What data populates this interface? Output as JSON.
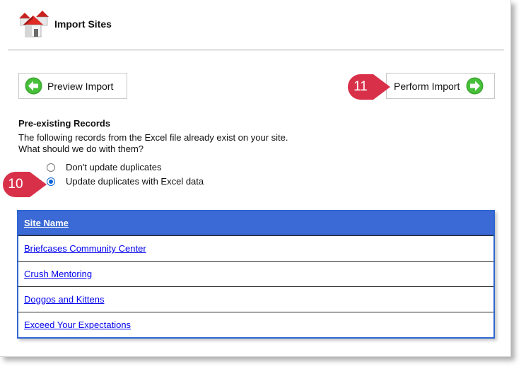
{
  "header": {
    "title": "Import Sites",
    "icon": "houses-icon"
  },
  "toolbar": {
    "preview_label": "Preview Import",
    "perform_label": "Perform Import"
  },
  "callouts": {
    "perform": "11",
    "radio": "10"
  },
  "section": {
    "title": "Pre-existing Records",
    "description_line1": "The following records from the Excel file already exist on your site.",
    "description_line2": "What should we do with them?"
  },
  "options": [
    {
      "label": "Don't update duplicates",
      "selected": false
    },
    {
      "label": "Update duplicates with Excel data",
      "selected": true
    }
  ],
  "table": {
    "header": "Site Name",
    "rows": [
      "Briefcases Community Center",
      "Crush Mentoring",
      "Doggos and Kittens",
      "Exceed Your Expectations"
    ]
  },
  "colors": {
    "table_header": "#3b69d5",
    "table_border": "#2f67d0",
    "callout": "#d9304a",
    "button_arrow": "#3aa72e",
    "link": "#0000ee"
  }
}
